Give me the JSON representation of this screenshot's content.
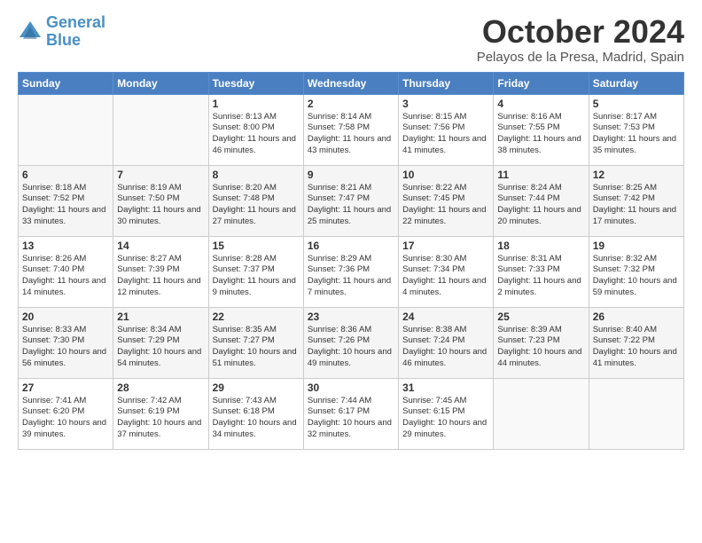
{
  "logo": {
    "line1": "General",
    "line2": "Blue"
  },
  "header": {
    "month": "October 2024",
    "location": "Pelayos de la Presa, Madrid, Spain"
  },
  "weekdays": [
    "Sunday",
    "Monday",
    "Tuesday",
    "Wednesday",
    "Thursday",
    "Friday",
    "Saturday"
  ],
  "weeks": [
    [
      {
        "day": "",
        "info": ""
      },
      {
        "day": "",
        "info": ""
      },
      {
        "day": "1",
        "info": "Sunrise: 8:13 AM\nSunset: 8:00 PM\nDaylight: 11 hours and 46 minutes."
      },
      {
        "day": "2",
        "info": "Sunrise: 8:14 AM\nSunset: 7:58 PM\nDaylight: 11 hours and 43 minutes."
      },
      {
        "day": "3",
        "info": "Sunrise: 8:15 AM\nSunset: 7:56 PM\nDaylight: 11 hours and 41 minutes."
      },
      {
        "day": "4",
        "info": "Sunrise: 8:16 AM\nSunset: 7:55 PM\nDaylight: 11 hours and 38 minutes."
      },
      {
        "day": "5",
        "info": "Sunrise: 8:17 AM\nSunset: 7:53 PM\nDaylight: 11 hours and 35 minutes."
      }
    ],
    [
      {
        "day": "6",
        "info": "Sunrise: 8:18 AM\nSunset: 7:52 PM\nDaylight: 11 hours and 33 minutes."
      },
      {
        "day": "7",
        "info": "Sunrise: 8:19 AM\nSunset: 7:50 PM\nDaylight: 11 hours and 30 minutes."
      },
      {
        "day": "8",
        "info": "Sunrise: 8:20 AM\nSunset: 7:48 PM\nDaylight: 11 hours and 27 minutes."
      },
      {
        "day": "9",
        "info": "Sunrise: 8:21 AM\nSunset: 7:47 PM\nDaylight: 11 hours and 25 minutes."
      },
      {
        "day": "10",
        "info": "Sunrise: 8:22 AM\nSunset: 7:45 PM\nDaylight: 11 hours and 22 minutes."
      },
      {
        "day": "11",
        "info": "Sunrise: 8:24 AM\nSunset: 7:44 PM\nDaylight: 11 hours and 20 minutes."
      },
      {
        "day": "12",
        "info": "Sunrise: 8:25 AM\nSunset: 7:42 PM\nDaylight: 11 hours and 17 minutes."
      }
    ],
    [
      {
        "day": "13",
        "info": "Sunrise: 8:26 AM\nSunset: 7:40 PM\nDaylight: 11 hours and 14 minutes."
      },
      {
        "day": "14",
        "info": "Sunrise: 8:27 AM\nSunset: 7:39 PM\nDaylight: 11 hours and 12 minutes."
      },
      {
        "day": "15",
        "info": "Sunrise: 8:28 AM\nSunset: 7:37 PM\nDaylight: 11 hours and 9 minutes."
      },
      {
        "day": "16",
        "info": "Sunrise: 8:29 AM\nSunset: 7:36 PM\nDaylight: 11 hours and 7 minutes."
      },
      {
        "day": "17",
        "info": "Sunrise: 8:30 AM\nSunset: 7:34 PM\nDaylight: 11 hours and 4 minutes."
      },
      {
        "day": "18",
        "info": "Sunrise: 8:31 AM\nSunset: 7:33 PM\nDaylight: 11 hours and 2 minutes."
      },
      {
        "day": "19",
        "info": "Sunrise: 8:32 AM\nSunset: 7:32 PM\nDaylight: 10 hours and 59 minutes."
      }
    ],
    [
      {
        "day": "20",
        "info": "Sunrise: 8:33 AM\nSunset: 7:30 PM\nDaylight: 10 hours and 56 minutes."
      },
      {
        "day": "21",
        "info": "Sunrise: 8:34 AM\nSunset: 7:29 PM\nDaylight: 10 hours and 54 minutes."
      },
      {
        "day": "22",
        "info": "Sunrise: 8:35 AM\nSunset: 7:27 PM\nDaylight: 10 hours and 51 minutes."
      },
      {
        "day": "23",
        "info": "Sunrise: 8:36 AM\nSunset: 7:26 PM\nDaylight: 10 hours and 49 minutes."
      },
      {
        "day": "24",
        "info": "Sunrise: 8:38 AM\nSunset: 7:24 PM\nDaylight: 10 hours and 46 minutes."
      },
      {
        "day": "25",
        "info": "Sunrise: 8:39 AM\nSunset: 7:23 PM\nDaylight: 10 hours and 44 minutes."
      },
      {
        "day": "26",
        "info": "Sunrise: 8:40 AM\nSunset: 7:22 PM\nDaylight: 10 hours and 41 minutes."
      }
    ],
    [
      {
        "day": "27",
        "info": "Sunrise: 7:41 AM\nSunset: 6:20 PM\nDaylight: 10 hours and 39 minutes."
      },
      {
        "day": "28",
        "info": "Sunrise: 7:42 AM\nSunset: 6:19 PM\nDaylight: 10 hours and 37 minutes."
      },
      {
        "day": "29",
        "info": "Sunrise: 7:43 AM\nSunset: 6:18 PM\nDaylight: 10 hours and 34 minutes."
      },
      {
        "day": "30",
        "info": "Sunrise: 7:44 AM\nSunset: 6:17 PM\nDaylight: 10 hours and 32 minutes."
      },
      {
        "day": "31",
        "info": "Sunrise: 7:45 AM\nSunset: 6:15 PM\nDaylight: 10 hours and 29 minutes."
      },
      {
        "day": "",
        "info": ""
      },
      {
        "day": "",
        "info": ""
      }
    ]
  ]
}
